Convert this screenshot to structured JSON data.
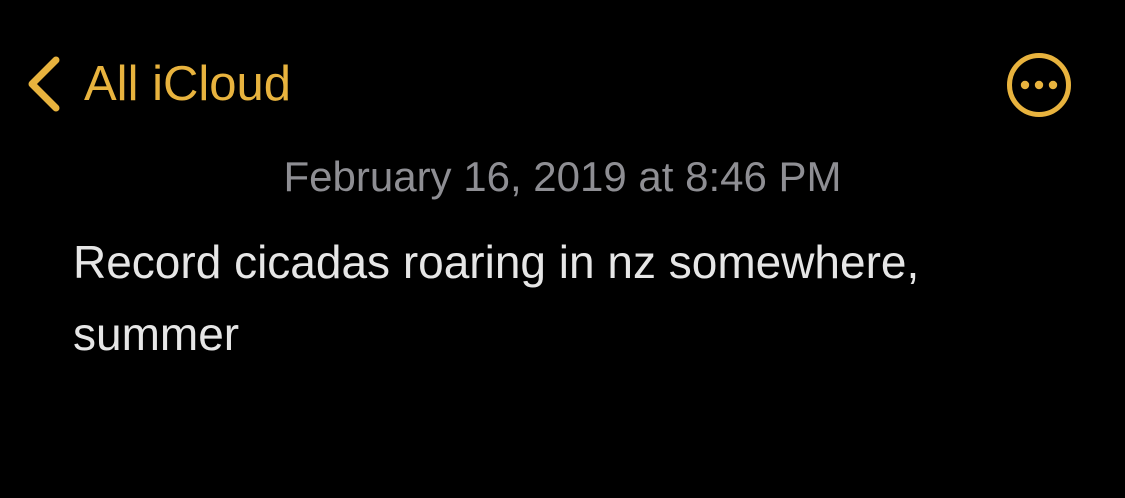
{
  "nav": {
    "back_label": "All iCloud",
    "back_icon": "chevron-left-icon",
    "more_icon": "ellipsis-circle-icon"
  },
  "note": {
    "date": "February 16, 2019 at 8:46 PM",
    "body": "Record cicadas roaring in nz somewhere,\nsummer"
  },
  "colors": {
    "background": "#000000",
    "accent": "#E8B33E",
    "date_text": "#8E8E93",
    "body_text": "#E6E6E6"
  }
}
